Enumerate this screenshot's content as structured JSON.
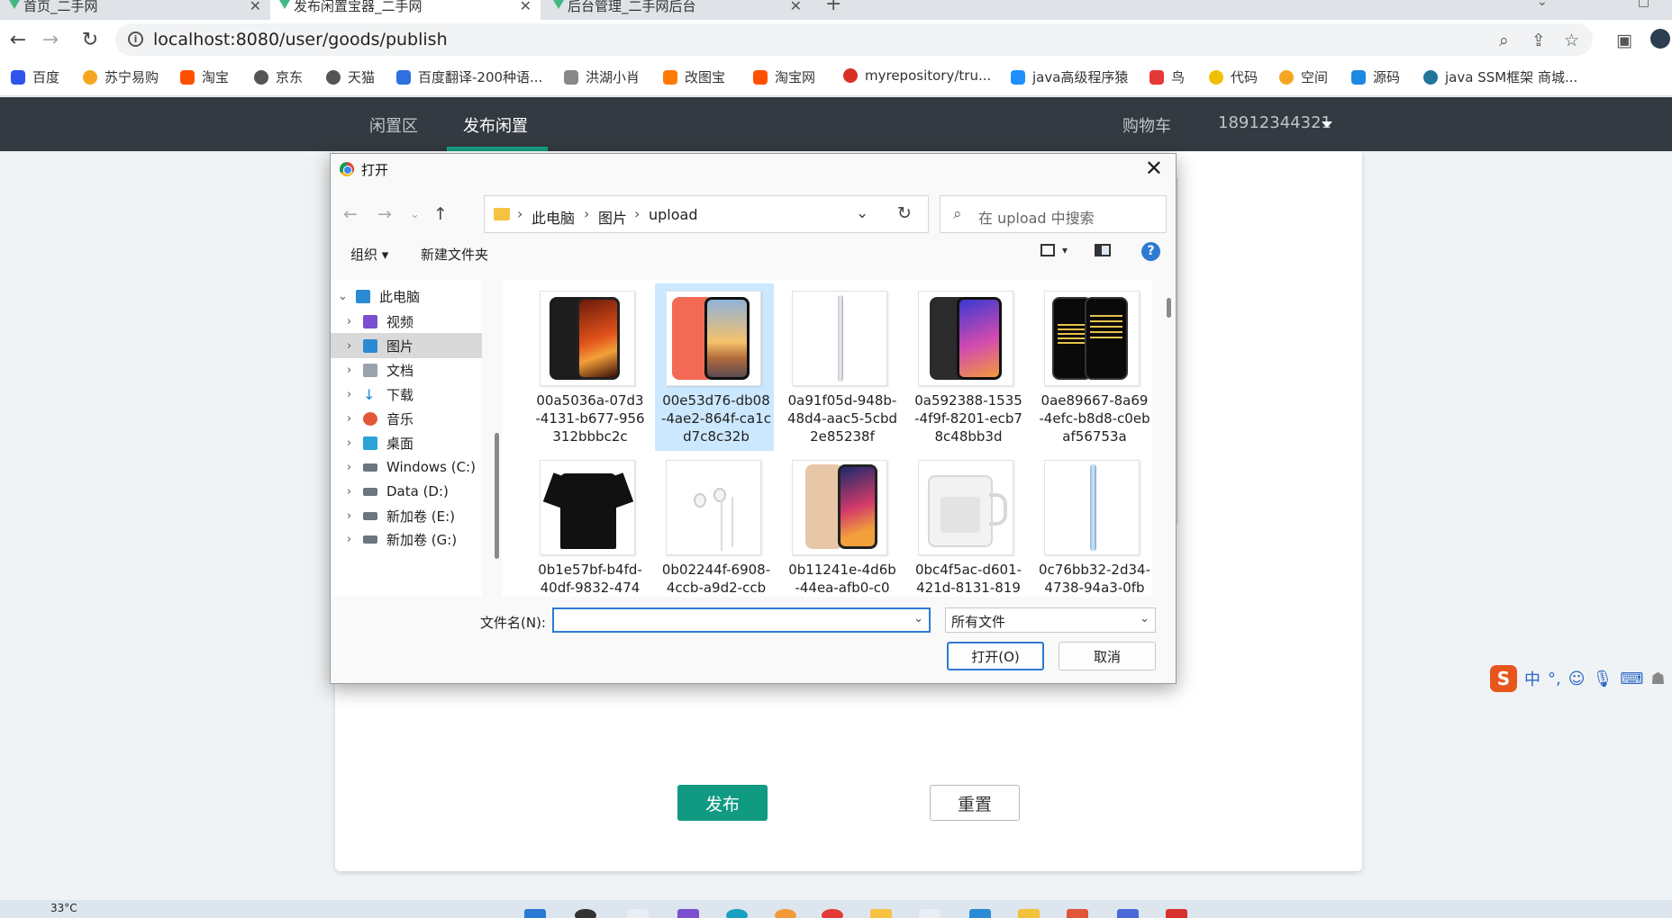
{
  "browser": {
    "tabs": [
      {
        "label": "首页_二手网"
      },
      {
        "label": "发布闲置宝器_二手网"
      },
      {
        "label": "后台管理_二手网后台"
      }
    ],
    "url": "localhost:8080/user/goods/publish",
    "bookmarks": [
      {
        "label": "百度",
        "color": "#2f54eb"
      },
      {
        "label": "苏宁易购",
        "color": "#f5a623"
      },
      {
        "label": "淘宝",
        "color": "#ff5000"
      },
      {
        "label": "京东",
        "color": "#555555"
      },
      {
        "label": "天猫",
        "color": "#555555"
      },
      {
        "label": "百度翻译-200种语...",
        "color": "#2f6fe0"
      },
      {
        "label": "洪湖小肖",
        "color": "#888888"
      },
      {
        "label": "改图宝",
        "color": "#ff7a00"
      },
      {
        "label": "淘宝网",
        "color": "#ff5000"
      },
      {
        "label": "myrepository/tru...",
        "color": "#d93025"
      },
      {
        "label": "java高级程序猿",
        "color": "#1e90ff"
      },
      {
        "label": "鸟",
        "color": "#e53935"
      },
      {
        "label": "代码",
        "color": "#f0c000"
      },
      {
        "label": "空间",
        "color": "#f5a623"
      },
      {
        "label": "源码",
        "color": "#1e88e5"
      },
      {
        "label": "java SSM框架 商城...",
        "color": "#21759b"
      }
    ]
  },
  "site_nav": {
    "left_links": [
      "闲置区",
      "发布闲置"
    ],
    "cart": "购物车",
    "user": "18912344321"
  },
  "page_form": {
    "publish_label": "发布",
    "reset_label": "重置"
  },
  "dialog": {
    "title": "打开",
    "path": [
      "此电脑",
      "图片",
      "upload"
    ],
    "search_placeholder": "在 upload 中搜索",
    "toolbar": {
      "organize": "组织 ▾",
      "new_folder": "新建文件夹",
      "help": "?"
    },
    "sidebar": [
      {
        "label": "此电脑",
        "icon": "computer-icon",
        "color": "#2a8ad4",
        "expanded": true
      },
      {
        "label": "视频",
        "icon": "video-icon",
        "color": "#7b4fd0"
      },
      {
        "label": "图片",
        "icon": "pictures-icon",
        "color": "#2a8ad4",
        "selected": true
      },
      {
        "label": "文档",
        "icon": "document-icon",
        "color": "#9aa3ad"
      },
      {
        "label": "下载",
        "icon": "download-icon",
        "color": "#1e8ad6"
      },
      {
        "label": "音乐",
        "icon": "music-icon",
        "color": "#e0573a"
      },
      {
        "label": "桌面",
        "icon": "desktop-icon",
        "color": "#2aa3d8"
      },
      {
        "label": "Windows (C:)",
        "icon": "drive-icon",
        "color": "#6c7680"
      },
      {
        "label": "Data (D:)",
        "icon": "drive-icon",
        "color": "#6c7680"
      },
      {
        "label": "新加卷 (E:)",
        "icon": "drive-icon",
        "color": "#6c7680"
      },
      {
        "label": "新加卷 (G:)",
        "icon": "drive-icon",
        "color": "#6c7680"
      }
    ],
    "files": [
      {
        "name": "00a5036a-07d3-4131-b677-956312bbbc2c",
        "art": "phone-fire"
      },
      {
        "name": "00e53d76-db08-4ae2-864f-ca1cd7c8c32b",
        "art": "phone-coral",
        "selected": true
      },
      {
        "name": "0a91f05d-948b-48d4-aac5-5cbd2e85238f",
        "art": "pen-silver"
      },
      {
        "name": "0a592388-1535-4f9f-8201-ecb78c48bb3d",
        "art": "phone-blue"
      },
      {
        "name": "0ae89667-8a69-4efc-b8d8-c0ebaf56753a",
        "art": "phone-moschino"
      },
      {
        "name": "0b1e57bf-b4fd-40df-9832-474",
        "art": "shirt-black"
      },
      {
        "name": "0b02244f-6908-4ccb-a9d2-ccb",
        "art": "earphones"
      },
      {
        "name": "0b11241e-4d6b-44ea-afb0-c0",
        "art": "phone-pink"
      },
      {
        "name": "0bc4f5ac-d601-421d-8131-819",
        "art": "glass-mug"
      },
      {
        "name": "0c76bb32-2d34-4738-94a3-0fb",
        "art": "pen-blue"
      }
    ],
    "filename_label": "文件名(N):",
    "filename_value": "",
    "filetype_value": "所有文件",
    "open_label": "打开(O)",
    "cancel_label": "取消"
  },
  "ime": {
    "logo": "S",
    "mode": "中",
    "punct": "°,"
  },
  "taskbar": {
    "temperature": "33°C"
  }
}
